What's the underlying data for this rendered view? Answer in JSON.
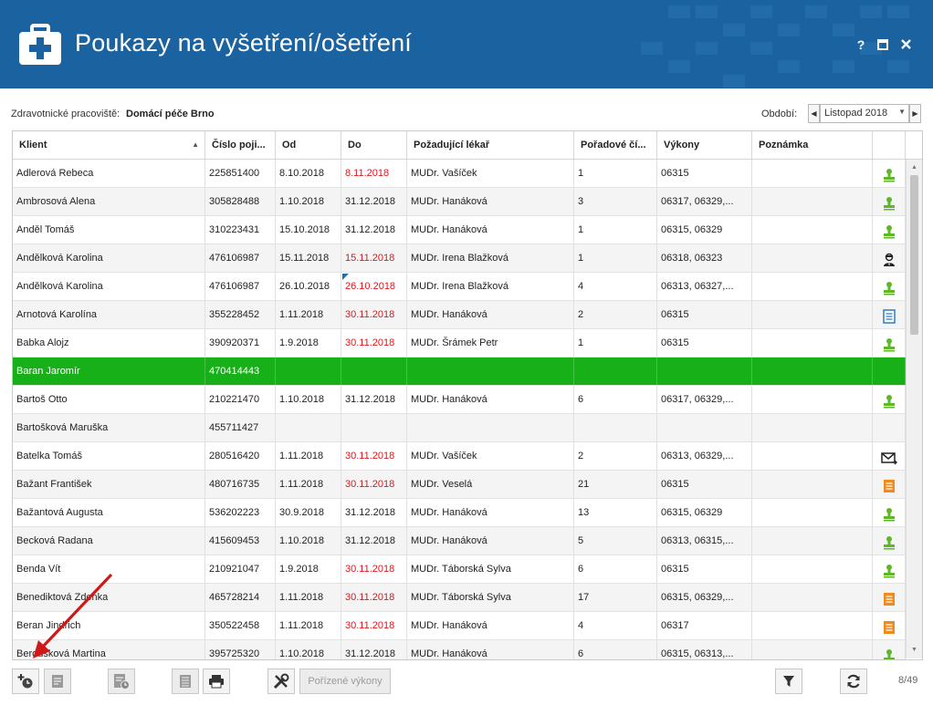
{
  "header": {
    "title": "Poukazy na vyšetření/ošetření",
    "help_label": "?",
    "maximize_label": "▣",
    "close_label": "✕"
  },
  "toolbar_top": {
    "workplace_label": "Zdravotnické pracoviště:",
    "workplace_value": "Domácí péče Brno",
    "period_label": "Období:",
    "period_value": "Listopad 2018"
  },
  "grid": {
    "columns": [
      "Klient",
      "Číslo poji...",
      "Od",
      "Do",
      "Požadující lékař",
      "Pořadové čí...",
      "Výkony",
      "Poznámka",
      ""
    ],
    "rows": [
      {
        "client": "Adlerová Rebeca",
        "ins": "225851400",
        "from": "8.10.2018",
        "to": "8.11.2018",
        "to_red": true,
        "doctor": "MUDr. Vašíček",
        "order": "1",
        "procs": "06315",
        "note": "",
        "icon": "stamp-green"
      },
      {
        "client": "Ambrosová Alena",
        "ins": "305828488",
        "from": "1.10.2018",
        "to": "31.12.2018",
        "to_red": false,
        "doctor": "MUDr. Hanáková",
        "order": "3",
        "procs": "06317, 06329,...",
        "note": "",
        "icon": "stamp-green"
      },
      {
        "client": "Anděl Tomáš",
        "ins": "310223431",
        "from": "15.10.2018",
        "to": "31.12.2018",
        "to_red": false,
        "doctor": "MUDr. Hanáková",
        "order": "1",
        "procs": "06315, 06329",
        "note": "",
        "icon": "stamp-green"
      },
      {
        "client": "Andělková Karolina",
        "ins": "476106987",
        "from": "15.11.2018",
        "to": "15.11.2018",
        "to_red": true,
        "doctor": "MUDr. Irena Blažková",
        "order": "1",
        "procs": "06318, 06323",
        "note": "",
        "icon": "doctor-black"
      },
      {
        "client": "Andělková Karolina",
        "ins": "476106987",
        "from": "26.10.2018",
        "to": "26.10.2018",
        "to_red": true,
        "flag": true,
        "doctor": "MUDr. Irena Blažková",
        "order": "4",
        "procs": "06313, 06327,...",
        "note": "",
        "icon": "stamp-green"
      },
      {
        "client": "Arnotová Karolína",
        "ins": "355228452",
        "from": "1.11.2018",
        "to": "30.11.2018",
        "to_red": true,
        "doctor": "MUDr. Hanáková",
        "order": "2",
        "procs": "06315",
        "note": "",
        "icon": "doc-blue"
      },
      {
        "client": "Babka Alojz",
        "ins": "390920371",
        "from": "1.9.2018",
        "to": "30.11.2018",
        "to_red": true,
        "doctor": "MUDr. Šrámek Petr",
        "order": "1",
        "procs": "06315",
        "note": "",
        "icon": "stamp-green"
      },
      {
        "client": "Baran Jaromír",
        "ins": "470414443",
        "from": "",
        "to": "",
        "to_red": false,
        "doctor": "",
        "order": "",
        "procs": "",
        "note": "",
        "icon": "",
        "selected": true
      },
      {
        "client": "Bartoš Otto",
        "ins": "210221470",
        "from": "1.10.2018",
        "to": "31.12.2018",
        "to_red": false,
        "doctor": "MUDr. Hanáková",
        "order": "6",
        "procs": "06317, 06329,...",
        "note": "",
        "icon": "stamp-green"
      },
      {
        "client": "Bartošková Maruška",
        "ins": "455711427",
        "from": "",
        "to": "",
        "to_red": false,
        "doctor": "",
        "order": "",
        "procs": "",
        "note": "",
        "icon": ""
      },
      {
        "client": "Batelka Tomáš",
        "ins": "280516420",
        "from": "1.11.2018",
        "to": "30.11.2018",
        "to_red": true,
        "doctor": "MUDr. Vašíček",
        "order": "2",
        "procs": "06313, 06329,...",
        "note": "",
        "icon": "mail-black"
      },
      {
        "client": "Bažant František",
        "ins": "480716735",
        "from": "1.11.2018",
        "to": "30.11.2018",
        "to_red": true,
        "doctor": "MUDr. Veselá",
        "order": "21",
        "procs": "06315",
        "note": "",
        "icon": "doc-orange"
      },
      {
        "client": "Bažantová Augusta",
        "ins": "536202223",
        "from": "30.9.2018",
        "to": "31.12.2018",
        "to_red": false,
        "doctor": "MUDr. Hanáková",
        "order": "13",
        "procs": "06315, 06329",
        "note": "",
        "icon": "stamp-green"
      },
      {
        "client": "Becková Radana",
        "ins": "415609453",
        "from": "1.10.2018",
        "to": "31.12.2018",
        "to_red": false,
        "doctor": "MUDr. Hanáková",
        "order": "5",
        "procs": "06313, 06315,...",
        "note": "",
        "icon": "stamp-green"
      },
      {
        "client": "Benda Vít",
        "ins": "210921047",
        "from": "1.9.2018",
        "to": "30.11.2018",
        "to_red": true,
        "doctor": "MUDr. Táborská Sylva",
        "order": "6",
        "procs": "06315",
        "note": "",
        "icon": "stamp-green"
      },
      {
        "client": "Benediktová Zdenka",
        "ins": "465728214",
        "from": "1.11.2018",
        "to": "30.11.2018",
        "to_red": true,
        "doctor": "MUDr. Táborská Sylva",
        "order": "17",
        "procs": "06315, 06329,...",
        "note": "",
        "icon": "doc-orange"
      },
      {
        "client": "Beran Jindřich",
        "ins": "350522458",
        "from": "1.11.2018",
        "to": "30.11.2018",
        "to_red": true,
        "doctor": "MUDr. Hanáková",
        "order": "4",
        "procs": "06317",
        "note": "",
        "icon": "doc-orange"
      },
      {
        "client": "Beroušková Martina",
        "ins": "395725320",
        "from": "1.10.2018",
        "to": "31.12.2018",
        "to_red": false,
        "doctor": "MUDr. Hanáková",
        "order": "6",
        "procs": "06315, 06313,...",
        "note": "",
        "icon": "stamp-green"
      }
    ]
  },
  "bottom_toolbar": {
    "recorded_procedures_label": "Pořízené výkony",
    "record_count": "8/49"
  },
  "colors": {
    "header_bg": "#1a63a0",
    "selection": "#18b018",
    "date_expired": "#e0161c",
    "icon_green": "#5cb825",
    "icon_orange": "#f08a1c",
    "icon_blue": "#2a7cc8"
  }
}
